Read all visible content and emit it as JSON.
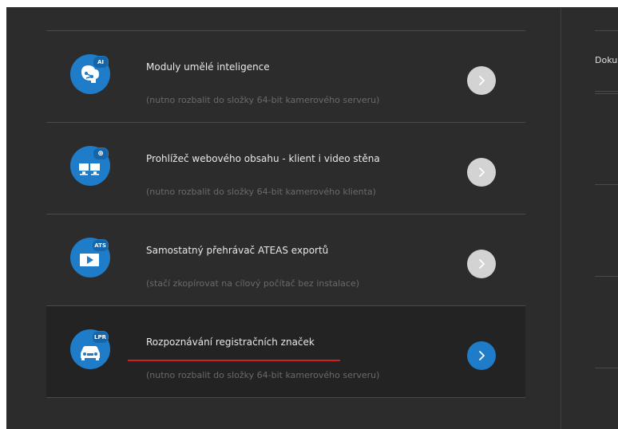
{
  "items": [
    {
      "title": "Moduly umělé inteligence",
      "subtitle": "(nutno rozbalit do složky 64-bit kamerového serveru)",
      "badge": "AI",
      "icon": "ai-brain-icon",
      "active": false
    },
    {
      "title": "Prohlížeč webového obsahu - klient i video stěna",
      "subtitle": "(nutno rozbalit do složky 64-bit kamerového klienta)",
      "badge": "",
      "icon": "web-monitors-icon",
      "active": false
    },
    {
      "title": "Samostatný přehrávač ATEAS exportů",
      "subtitle": "(stačí zkopírovat na cílový počítač bez instalace)",
      "badge": "ATS",
      "icon": "video-player-icon",
      "active": false
    },
    {
      "title": "Rozpoznávání registračních značek",
      "subtitle": "(nutno rozbalit do složky 64-bit kamerového serveru)",
      "badge": "LPR",
      "icon": "car-lpr-icon",
      "active": true
    }
  ],
  "right_column": {
    "partial_text": "Doku"
  },
  "colors": {
    "background": "#2c2c2c",
    "accent_blue": "#1e7cc8",
    "arrow_inactive": "#d3d3d3",
    "annotation_underline": "#d71f1f"
  }
}
